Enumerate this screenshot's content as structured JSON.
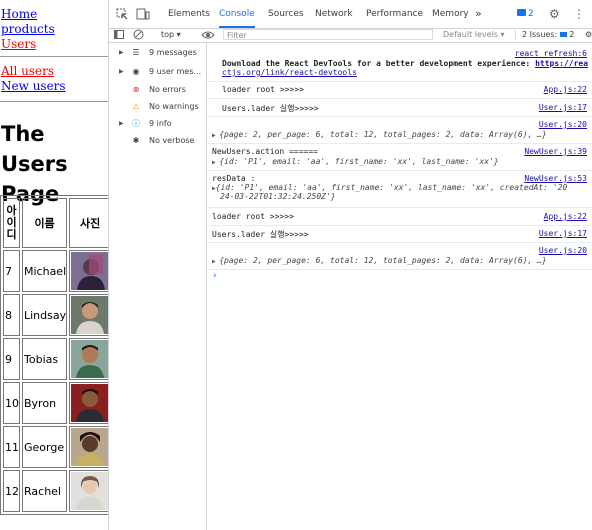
{
  "page": {
    "nav_top": [
      "Home",
      "products",
      "Users"
    ],
    "nav_users": [
      "All users",
      "New users"
    ],
    "title": "The Users Page",
    "table": {
      "headers": [
        "아이디",
        "이름",
        "사진"
      ],
      "rows": [
        {
          "id": "7",
          "name": "Michael"
        },
        {
          "id": "8",
          "name": "Lindsay"
        },
        {
          "id": "9",
          "name": "Tobias"
        },
        {
          "id": "10",
          "name": "Byron"
        },
        {
          "id": "11",
          "name": "George"
        },
        {
          "id": "12",
          "name": "Rachel"
        }
      ]
    }
  },
  "devtools": {
    "tabs": [
      "Elements",
      "Console",
      "Sources",
      "Network",
      "Performance",
      "Memory",
      "»"
    ],
    "active_tab": "Console",
    "badge_count": "2",
    "context": "top",
    "filter_placeholder": "Filter",
    "levels": "Default levels",
    "issues": "2 Issues:",
    "issues_count": "2",
    "sidebar": [
      {
        "icon": "list-icon",
        "label": "9 messages"
      },
      {
        "icon": "user-icon",
        "label": "9 user mes..."
      },
      {
        "icon": "error-icon",
        "label": "No errors"
      },
      {
        "icon": "warning-icon",
        "label": "No warnings"
      },
      {
        "icon": "info-icon",
        "label": "9 info"
      },
      {
        "icon": "bug-icon",
        "label": "No verbose"
      }
    ],
    "messages": {
      "m1_src": "react_refresh:6",
      "m1_text": "Download the React DevTools for a better development experience: ",
      "m1_link": "https://rea",
      "m1_link2": "ctjs.org/link/react-devtools",
      "m2_text": "loader root >>>>>",
      "m2_src": "App.js:22",
      "m3_text": "Users.lader 실행>>>>>",
      "m3_src": "User.js:17",
      "m4_src": "User.js:20",
      "m4_obj": "{page: 2, per_page: 6, total: 12, total_pages: 2, data: Array(6), …}",
      "m5_text": "NewUsers.action ======",
      "m5_src": "NewUser.js:39",
      "m5_obj": "{id: 'P1', email: 'aa', first_name: 'xx', last_name: 'xx'}",
      "m6_text": "resData :",
      "m6_src": "NewUser.js:53",
      "m6_obj1": "{id: 'P1', email: 'aa', first_name: 'xx', last_name: 'xx', createdAt: '20",
      "m6_obj2": "24-03-22T01:32:24.250Z'}",
      "m7_text": "loader root >>>>>",
      "m7_src": "App.js:22",
      "m8_text": "Users.lader 실행>>>>>",
      "m8_src": "User.js:17",
      "m9_src": "User.js:20",
      "m9_obj": "{page: 2, per_page: 6, total: 12, total_pages: 2, data: Array(6), …}"
    }
  },
  "colors": {
    "accent": "#1a73e8",
    "error": "#d93025",
    "warning": "#f29900",
    "link": "#0000ee",
    "active_link": "#e00000"
  }
}
